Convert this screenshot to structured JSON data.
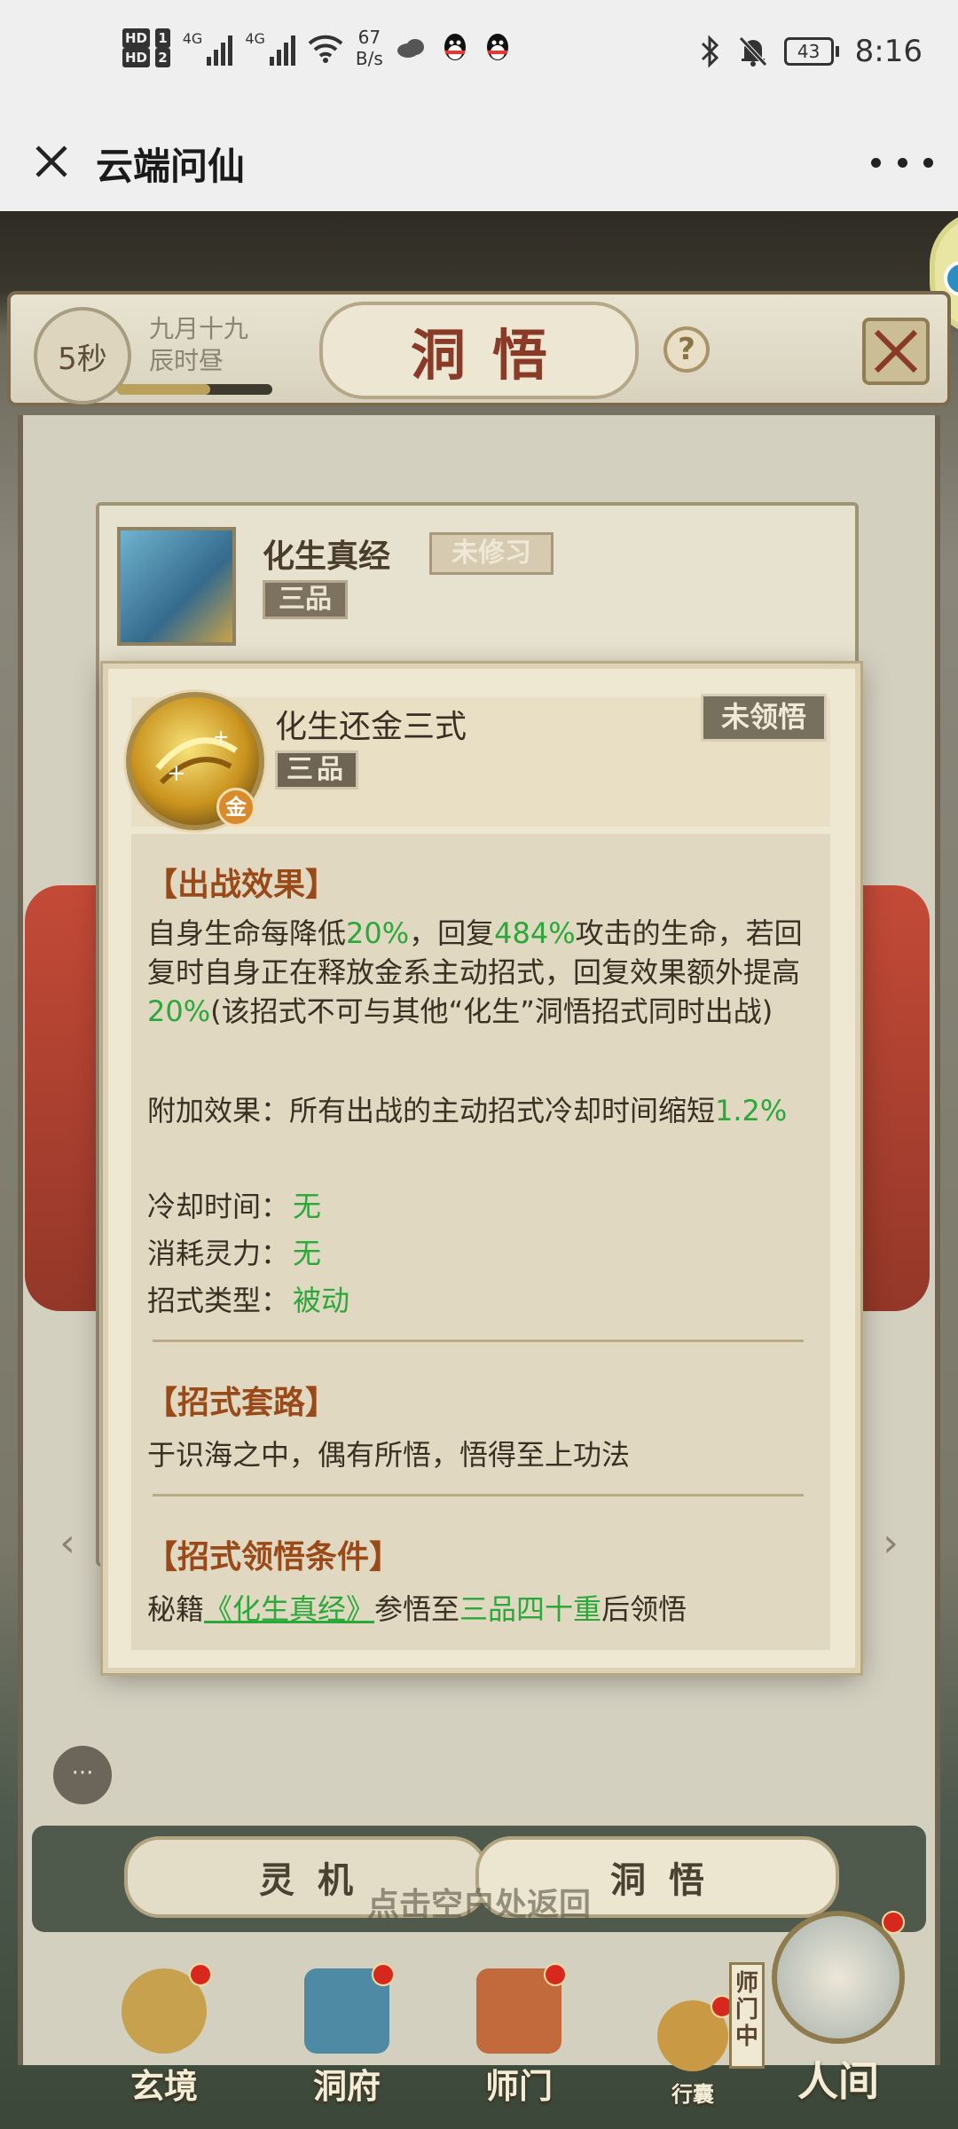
{
  "status_bar": {
    "hd1": "HD",
    "sim1": "1",
    "hd2": "HD",
    "sim2": "2",
    "net1": "4G",
    "net2": "4G",
    "speed_value": "67",
    "speed_unit": "B/s",
    "battery": "43",
    "time": "8:16"
  },
  "title_bar": {
    "title": "云端问仙"
  },
  "game": {
    "timer": "5秒",
    "date_line1": "九月十九",
    "date_line2": "辰时昼",
    "day_progress": 0.6,
    "header": "洞悟",
    "help": "?",
    "book": {
      "name": "化生真经",
      "status": "未修习",
      "grade": "三品"
    },
    "arrow_left": "‹",
    "arrow_right": "›",
    "chat": "···",
    "tabs": {
      "lingji": "灵机",
      "dongwu": "洞悟"
    },
    "hint": "点击空白处返回",
    "nav": {
      "xuanjing": "玄境",
      "dongfu": "洞府",
      "shimen": "师门",
      "xingnang": "行囊",
      "renjian": "人间",
      "shimen_tag": "师门中"
    }
  },
  "modal": {
    "skill_name": "化生还金三式",
    "grade": "三品",
    "status": "未领悟",
    "element_badge": "金",
    "section1_title": "【出战效果】",
    "effect": {
      "p1": "自身生命每降低",
      "v1": "20%",
      "p2": "，回复",
      "v2": "484%",
      "p3": "攻击的生命，若回复时自身正在释放金系主动招式，回复效果额外提高",
      "v3": "20%",
      "p4": "(该招式不可与其他“化生”洞悟招式同时出战)"
    },
    "extra": {
      "label": "附加效果：所有出战的主动招式冷却时间缩短",
      "value": "1.2%"
    },
    "cooldown": {
      "label": "冷却时间：",
      "value": "无"
    },
    "cost": {
      "label": "消耗灵力：",
      "value": "无"
    },
    "type": {
      "label": "招式类型：",
      "value": "被动"
    },
    "section2_title": "【招式套路】",
    "routine": "于识海之中，偶有所悟，悟得至上功法",
    "section3_title": "【招式领悟条件】",
    "condition": {
      "p1": "秘籍",
      "book": "《化生真经》",
      "p2": "参悟至",
      "level": "三品四十重",
      "p3": "后领悟"
    }
  },
  "colors": {
    "highlight_green": "#2aa83a",
    "section_title": "#9a4a18",
    "header_red": "#8a3b28"
  }
}
